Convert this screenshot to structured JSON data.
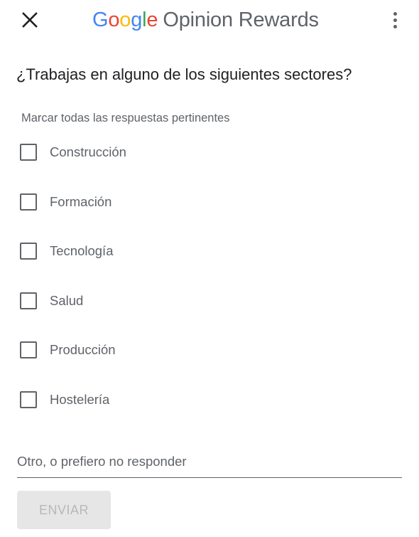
{
  "header": {
    "close_icon": "close-icon",
    "brand_letters": [
      {
        "ch": "G",
        "color": "#4285F4"
      },
      {
        "ch": "o",
        "color": "#EA4335"
      },
      {
        "ch": "o",
        "color": "#FBBC05"
      },
      {
        "ch": "g",
        "color": "#4285F4"
      },
      {
        "ch": "l",
        "color": "#34A853"
      },
      {
        "ch": "e",
        "color": "#EA4335"
      }
    ],
    "brand": "Google",
    "app_name": "Opinion Rewards",
    "menu_icon": "more-vert-icon"
  },
  "survey": {
    "question": "¿Trabajas en alguno de los siguientes sectores?",
    "hint": "Marcar todas las respuestas pertinentes",
    "options": [
      {
        "label": "Construcción",
        "checked": false
      },
      {
        "label": "Formación",
        "checked": false
      },
      {
        "label": "Tecnología",
        "checked": false
      },
      {
        "label": "Salud",
        "checked": false
      },
      {
        "label": "Producción",
        "checked": false
      },
      {
        "label": "Hostelería",
        "checked": false
      }
    ],
    "other_placeholder": "Otro, o prefiero no responder",
    "other_value": "",
    "submit_label": "ENVIAR",
    "submit_enabled": false
  },
  "colors": {
    "text_primary": "#202124",
    "text_secondary": "#5f6368",
    "button_disabled_bg": "#e6e6e6",
    "button_disabled_text": "#b8b8b8"
  }
}
